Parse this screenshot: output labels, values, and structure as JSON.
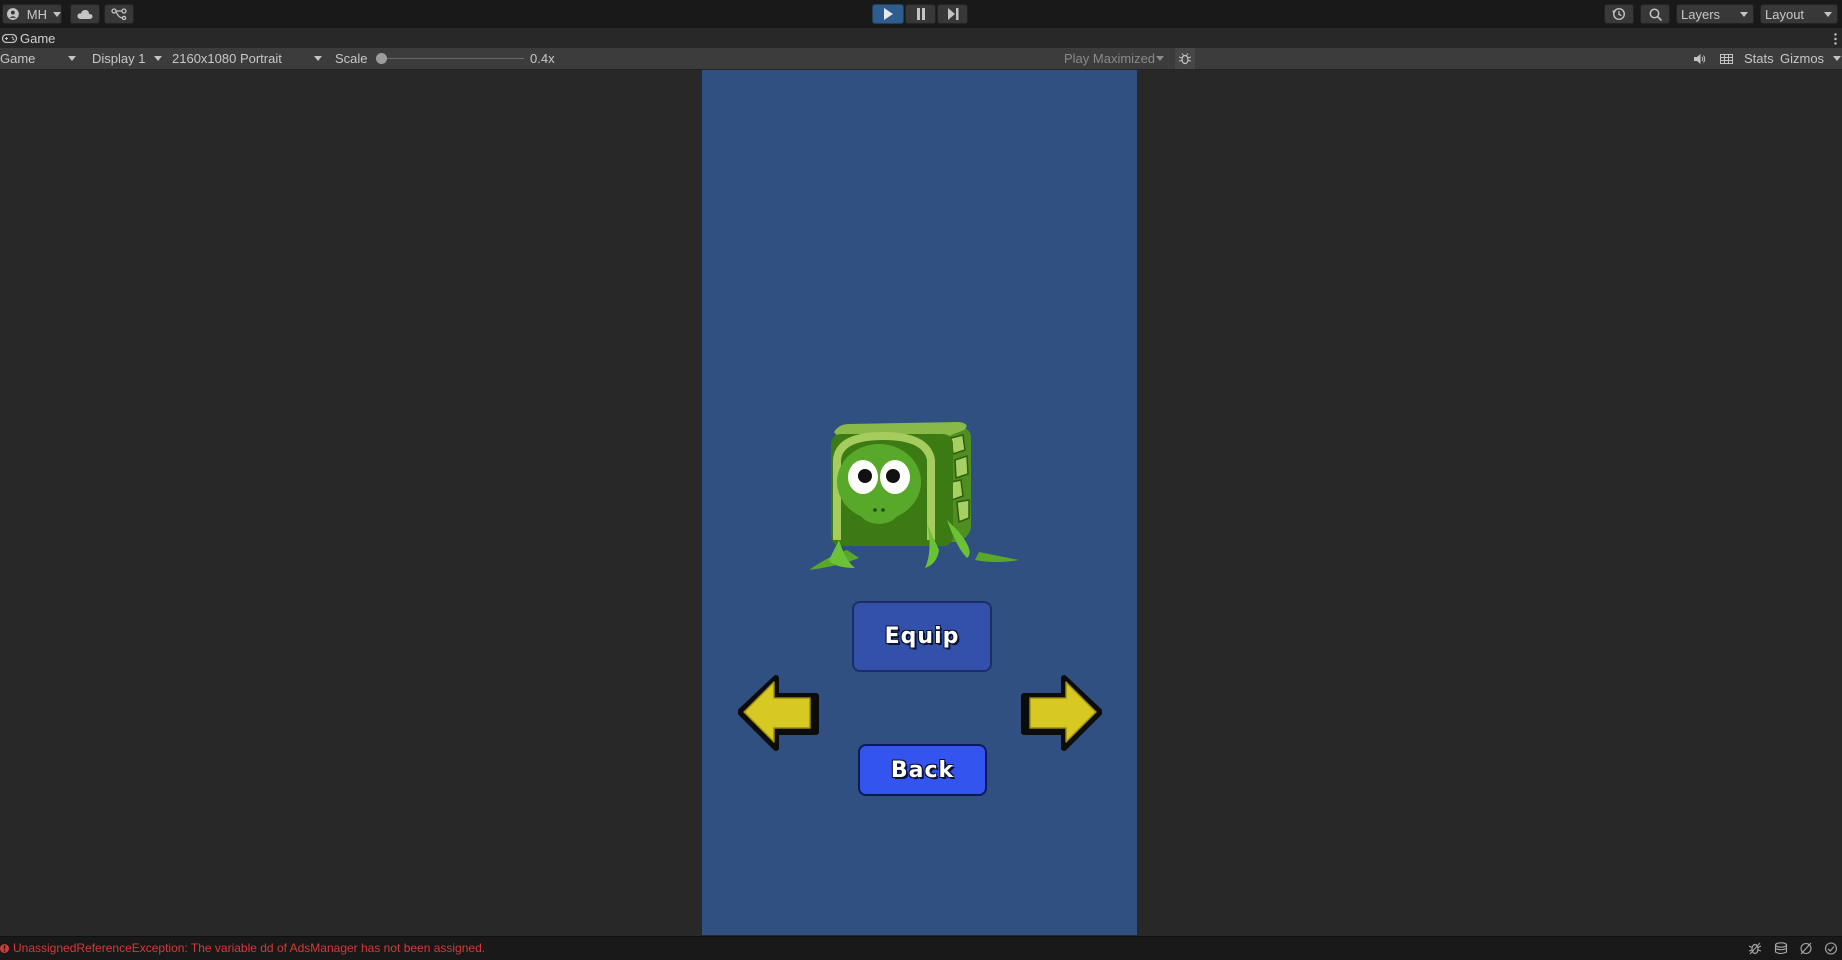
{
  "toolbar": {
    "account_label": "MH",
    "layers_label": "Layers",
    "layout_label": "Layout"
  },
  "tab": {
    "label": "Game"
  },
  "controls": {
    "mode": "Game",
    "display": "Display 1",
    "resolution": "2160x1080 Portrait",
    "scale_label": "Scale",
    "scale_value": "0.4x",
    "play_mode": "Play Maximized",
    "stats": "Stats",
    "gizmos": "Gizmos"
  },
  "game": {
    "equip_label": "Equip",
    "back_label": "Back"
  },
  "status": {
    "message": "UnassignedReferenceException: The variable dd of AdsManager has not been assigned."
  },
  "colors": {
    "play_active": "#2d5d8f",
    "game_background": "#2f5080",
    "equip_button": "#3350aa",
    "back_button": "#3354ee",
    "arrow_yellow": "#d8c822",
    "error_red": "#d23b3b"
  }
}
